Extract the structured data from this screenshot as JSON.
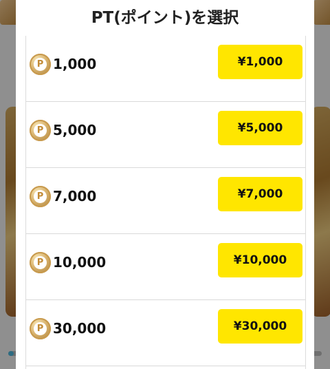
{
  "modal": {
    "title": "PT(ポイント)を選択"
  },
  "coin_symbol": "P",
  "options": [
    {
      "points": "1,000",
      "price": "¥1,000"
    },
    {
      "points": "5,000",
      "price": "¥5,000"
    },
    {
      "points": "7,000",
      "price": "¥7,000"
    },
    {
      "points": "10,000",
      "price": "¥10,000"
    },
    {
      "points": "30,000",
      "price": "¥30,000"
    }
  ],
  "colors": {
    "button": "#ffe600",
    "overlay": "#8f8f8f",
    "coin": "#d9b470"
  }
}
